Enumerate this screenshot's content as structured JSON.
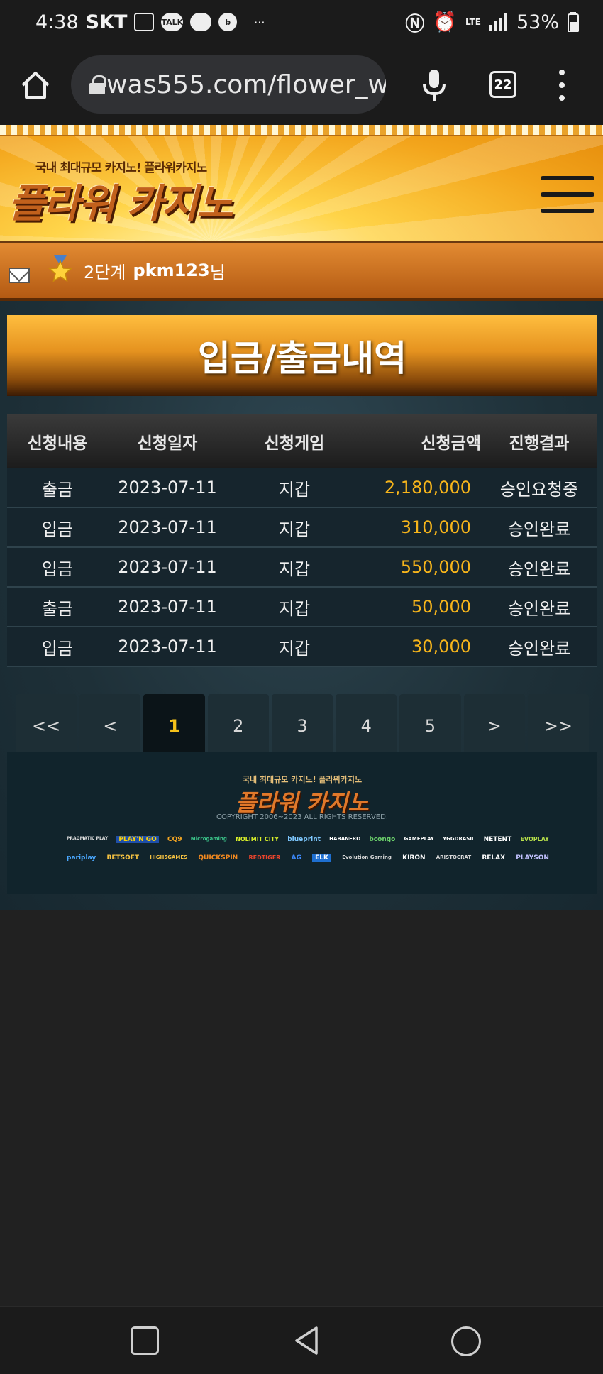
{
  "status_bar": {
    "time": "4:38",
    "carrier": "SKT",
    "talk_badge": "TALK",
    "more_indicator": "···",
    "network": "LTE",
    "battery": "53%"
  },
  "browser": {
    "url": "was555.com/flower_w",
    "tab_count": "22"
  },
  "site": {
    "logo_tagline": "국내 최대규모 카지노! 플라워카지노",
    "logo_title": "플라워 카지노"
  },
  "user": {
    "level": "2단계",
    "username": "pkm123",
    "suffix": "님"
  },
  "page_title": "입금/출금내역",
  "table": {
    "headers": [
      "신청내용",
      "신청일자",
      "신청게임",
      "신청금액",
      "진행결과"
    ],
    "rows": [
      {
        "type": "출금",
        "date": "2023-07-11",
        "game": "지갑",
        "amount": "2,180,000",
        "status": "승인요청중"
      },
      {
        "type": "입금",
        "date": "2023-07-11",
        "game": "지갑",
        "amount": "310,000",
        "status": "승인완료"
      },
      {
        "type": "입금",
        "date": "2023-07-11",
        "game": "지갑",
        "amount": "550,000",
        "status": "승인완료"
      },
      {
        "type": "출금",
        "date": "2023-07-11",
        "game": "지갑",
        "amount": "50,000",
        "status": "승인완료"
      },
      {
        "type": "입금",
        "date": "2023-07-11",
        "game": "지갑",
        "amount": "30,000",
        "status": "승인완료"
      }
    ]
  },
  "pagination": {
    "first": "<<",
    "prev": "<",
    "pages": [
      "1",
      "2",
      "3",
      "4",
      "5"
    ],
    "current": "1",
    "next": ">",
    "last": ">>"
  },
  "footer": {
    "tagline": "국내 최대규모 카지노! 플라워카지노",
    "logo_title": "플라워 카지노",
    "copyright": "COPYRIGHT  2006~2023 ALL RIGHTS RESERVED.",
    "providers_row1": [
      "PRAGMATIC PLAY",
      "PLAY'N GO",
      "CQ9",
      "Microgaming",
      "NOLIMIT CITY",
      "blueprint",
      "HABANERO",
      "bcongo",
      "GAMEPLAY",
      "YGGDRASIL",
      "NETENT",
      "EVOPLAY"
    ],
    "providers_row2": [
      "pariplay",
      "BETSOFT",
      "HIGH5GAMES",
      "QUICKSPIN",
      "REDTIGER",
      "AG",
      "ELK",
      "Evolution Gaming",
      "KIRON",
      "ARISTOCRAT",
      "RELAX",
      "PLAYSON"
    ]
  },
  "colors": {
    "accent_amount": "#f7b51b",
    "page_bg": "#1e3038",
    "header_gold": "#f3a51c"
  }
}
